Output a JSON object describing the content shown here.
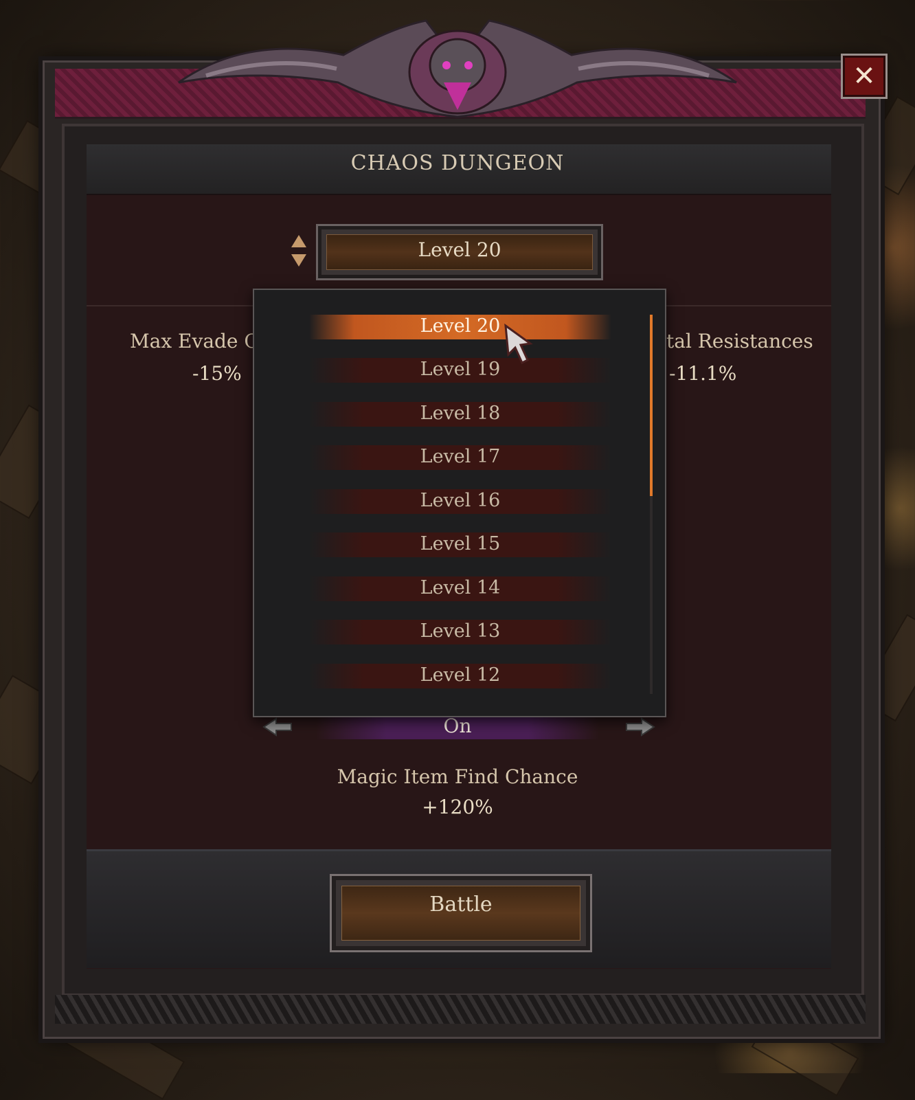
{
  "dialog": {
    "title": "CHAOS DUNGEON",
    "close_icon": "✕",
    "accent_color": "#d46a25"
  },
  "level_selector": {
    "current": "Level 20",
    "options": [
      "Level 20",
      "Level 19",
      "Level 18",
      "Level 17",
      "Level 16",
      "Level 15",
      "Level 14",
      "Level 13",
      "Level 12"
    ],
    "selected_index": 0,
    "scroll_fraction_visible": 0.48
  },
  "modifiers": {
    "left": {
      "label": "Max Evade Ch",
      "value": "-15%"
    },
    "right": {
      "label": "tal Resistances",
      "value": "-11.1%"
    }
  },
  "toggle": {
    "value": "On",
    "prev_icon": "arrow-left-icon",
    "next_icon": "arrow-right-icon"
  },
  "reward": {
    "label": "Magic Item Find Chance",
    "value": "+120%"
  },
  "footer": {
    "battle_label": "Battle"
  }
}
